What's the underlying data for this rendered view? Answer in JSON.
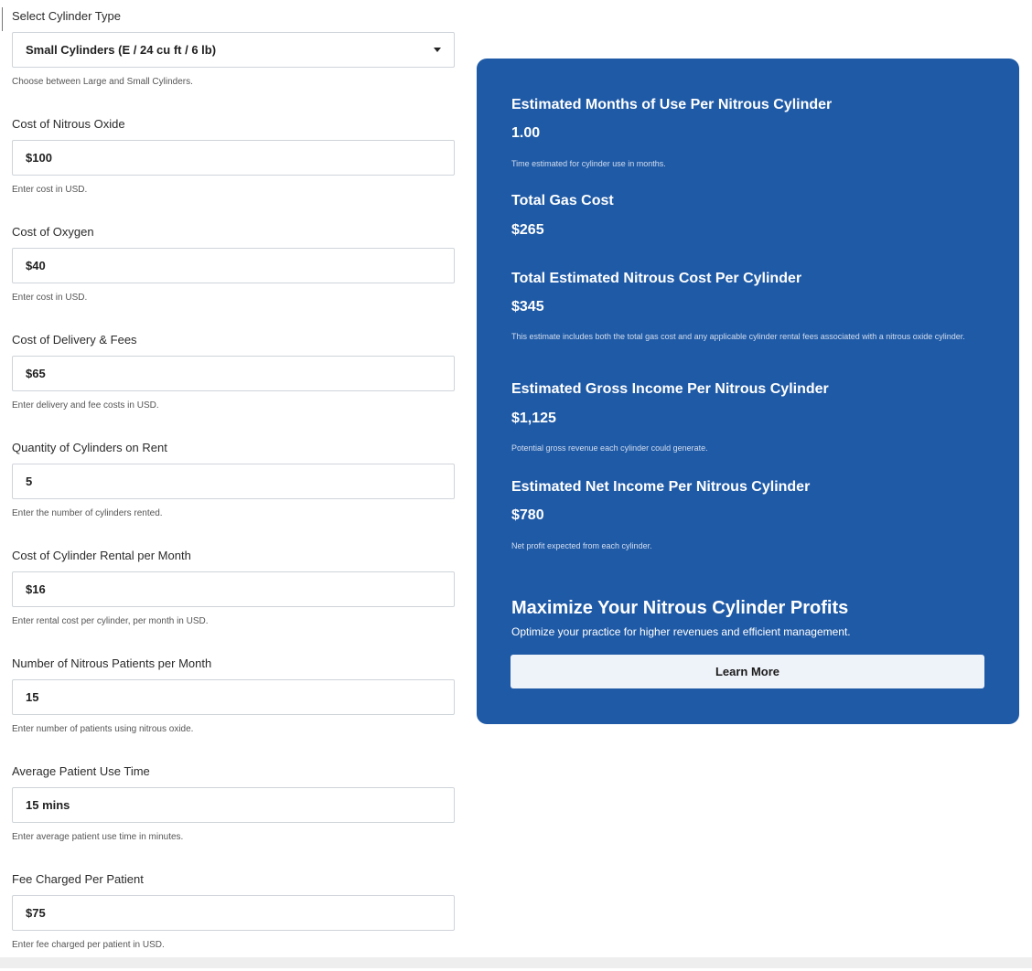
{
  "form": {
    "fields": [
      {
        "label": "Select Cylinder Type",
        "value": "Small Cylinders (E / 24 cu ft / 6 lb)",
        "help": "Choose between Large and Small Cylinders."
      },
      {
        "label": "Cost of Nitrous Oxide",
        "value": "$100",
        "help": "Enter cost in USD."
      },
      {
        "label": "Cost of Oxygen",
        "value": "$40",
        "help": "Enter cost in USD."
      },
      {
        "label": "Cost of Delivery & Fees",
        "value": "$65",
        "help": "Enter delivery and fee costs in USD."
      },
      {
        "label": "Quantity of Cylinders on Rent",
        "value": "5",
        "help": "Enter the number of cylinders rented."
      },
      {
        "label": "Cost of Cylinder Rental per Month",
        "value": "$16",
        "help": "Enter rental cost per cylinder, per month in USD."
      },
      {
        "label": "Number of Nitrous Patients per Month",
        "value": "15",
        "help": "Enter number of patients using nitrous oxide."
      },
      {
        "label": "Average Patient Use Time",
        "value": "15 mins",
        "help": "Enter average patient use time in minutes."
      },
      {
        "label": "Fee Charged Per Patient",
        "value": "$75",
        "help": "Enter fee charged per patient in USD."
      }
    ]
  },
  "results": {
    "months_title": "Estimated Months of Use Per Nitrous Cylinder",
    "months_value": "1.00",
    "months_note": "Time estimated for cylinder use in months.",
    "gas_title": "Total Gas Cost",
    "gas_value": "$265",
    "nitrous_title": "Total Estimated Nitrous Cost Per Cylinder",
    "nitrous_value": "$345",
    "nitrous_note": "This estimate includes both the total gas cost and any applicable cylinder rental fees associated with a nitrous oxide cylinder.",
    "gross_title": "Estimated Gross Income Per Nitrous Cylinder",
    "gross_value": "$1,125",
    "gross_note": "Potential gross revenue each cylinder could generate.",
    "net_title": "Estimated Net Income Per Nitrous Cylinder",
    "net_value": "$780",
    "net_note": "Net profit expected from each cylinder."
  },
  "promo": {
    "title": "Maximize Your Nitrous Cylinder Profits",
    "text": "Optimize your practice for higher revenues and efficient management.",
    "button_label": "Learn More"
  },
  "colors": {
    "card_background": "#1f5aa6",
    "button_background": "#eef2f9"
  },
  "icons": {
    "dropdown": "chevron-down-icon"
  }
}
